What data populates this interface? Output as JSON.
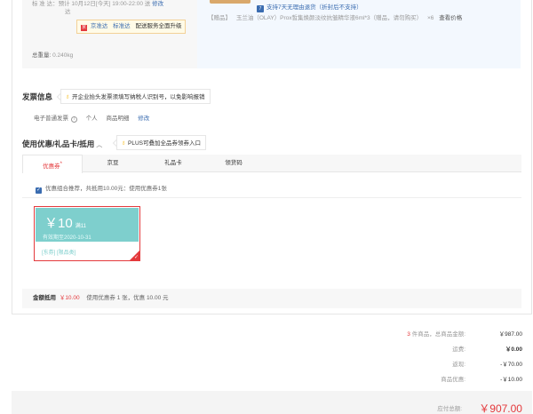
{
  "delivery": {
    "line1": "标 准 达：预计 10月12日[今天] 19:00-22:00 送",
    "line1_edit": "修改",
    "line2": "达",
    "tag_icon": "京",
    "tag_parts": [
      "京准达",
      "标准达",
      "配送服务全面升级"
    ],
    "weight_label": "总重量:",
    "weight_value": "0.240kg"
  },
  "goods": {
    "return_icon": "7",
    "return_text": "支持7天无理由退货（折封后不支持）",
    "gift_tag": "【赠品】",
    "gift_name": "玉兰油（OLAY）Prox皙集焕颜淡纹抗皱精华液6ml*3（赠品，请勿购买）",
    "gift_qty": "×6",
    "gift_link": "查看价格"
  },
  "invoice": {
    "title": "发票信息",
    "tip": "开企业抬头发票须填写纳税人识别号，以免影响报销",
    "type": "电子普通发票",
    "info_icon": "i",
    "payer": "个人",
    "content": "商品明细",
    "edit": "修改"
  },
  "coupons": {
    "title": "使用优惠/礼品卡/抵用",
    "chevron": "︿",
    "tip": "PLUS可叠加全品券领券入口",
    "tabs": [
      "优惠券",
      "京豆",
      "礼品卡",
      "领货码"
    ],
    "active_mark": "*",
    "combo_text": "优惠组合推荐，共抵用10.00元：使用优惠券1张",
    "card": {
      "amount": "￥10",
      "condition": "满11",
      "expiry": "有效期至2020-10-31",
      "scope": "[东券] [限品类]"
    },
    "deduct_label": "金额抵用",
    "deduct_value": "￥10.00",
    "deduct_detail": "使用优惠券 1 张，优惠 10.00 元"
  },
  "summary": {
    "items_count": "3",
    "items_label": "件商品，总商品金额:",
    "items_value": "￥987.00",
    "shipping_label": "运费:",
    "shipping_value": "￥0.00",
    "cashback_label": "返现:",
    "cashback_value": "-￥70.00",
    "discount_label": "商品优惠:",
    "discount_value": "-￥10.00",
    "total_label": "应付总额:",
    "total_value": "￥907.00"
  },
  "colors": {
    "accent_red": "#e4393c",
    "link_blue": "#3a6cb0",
    "coupon_teal": "#7ecfcd"
  }
}
